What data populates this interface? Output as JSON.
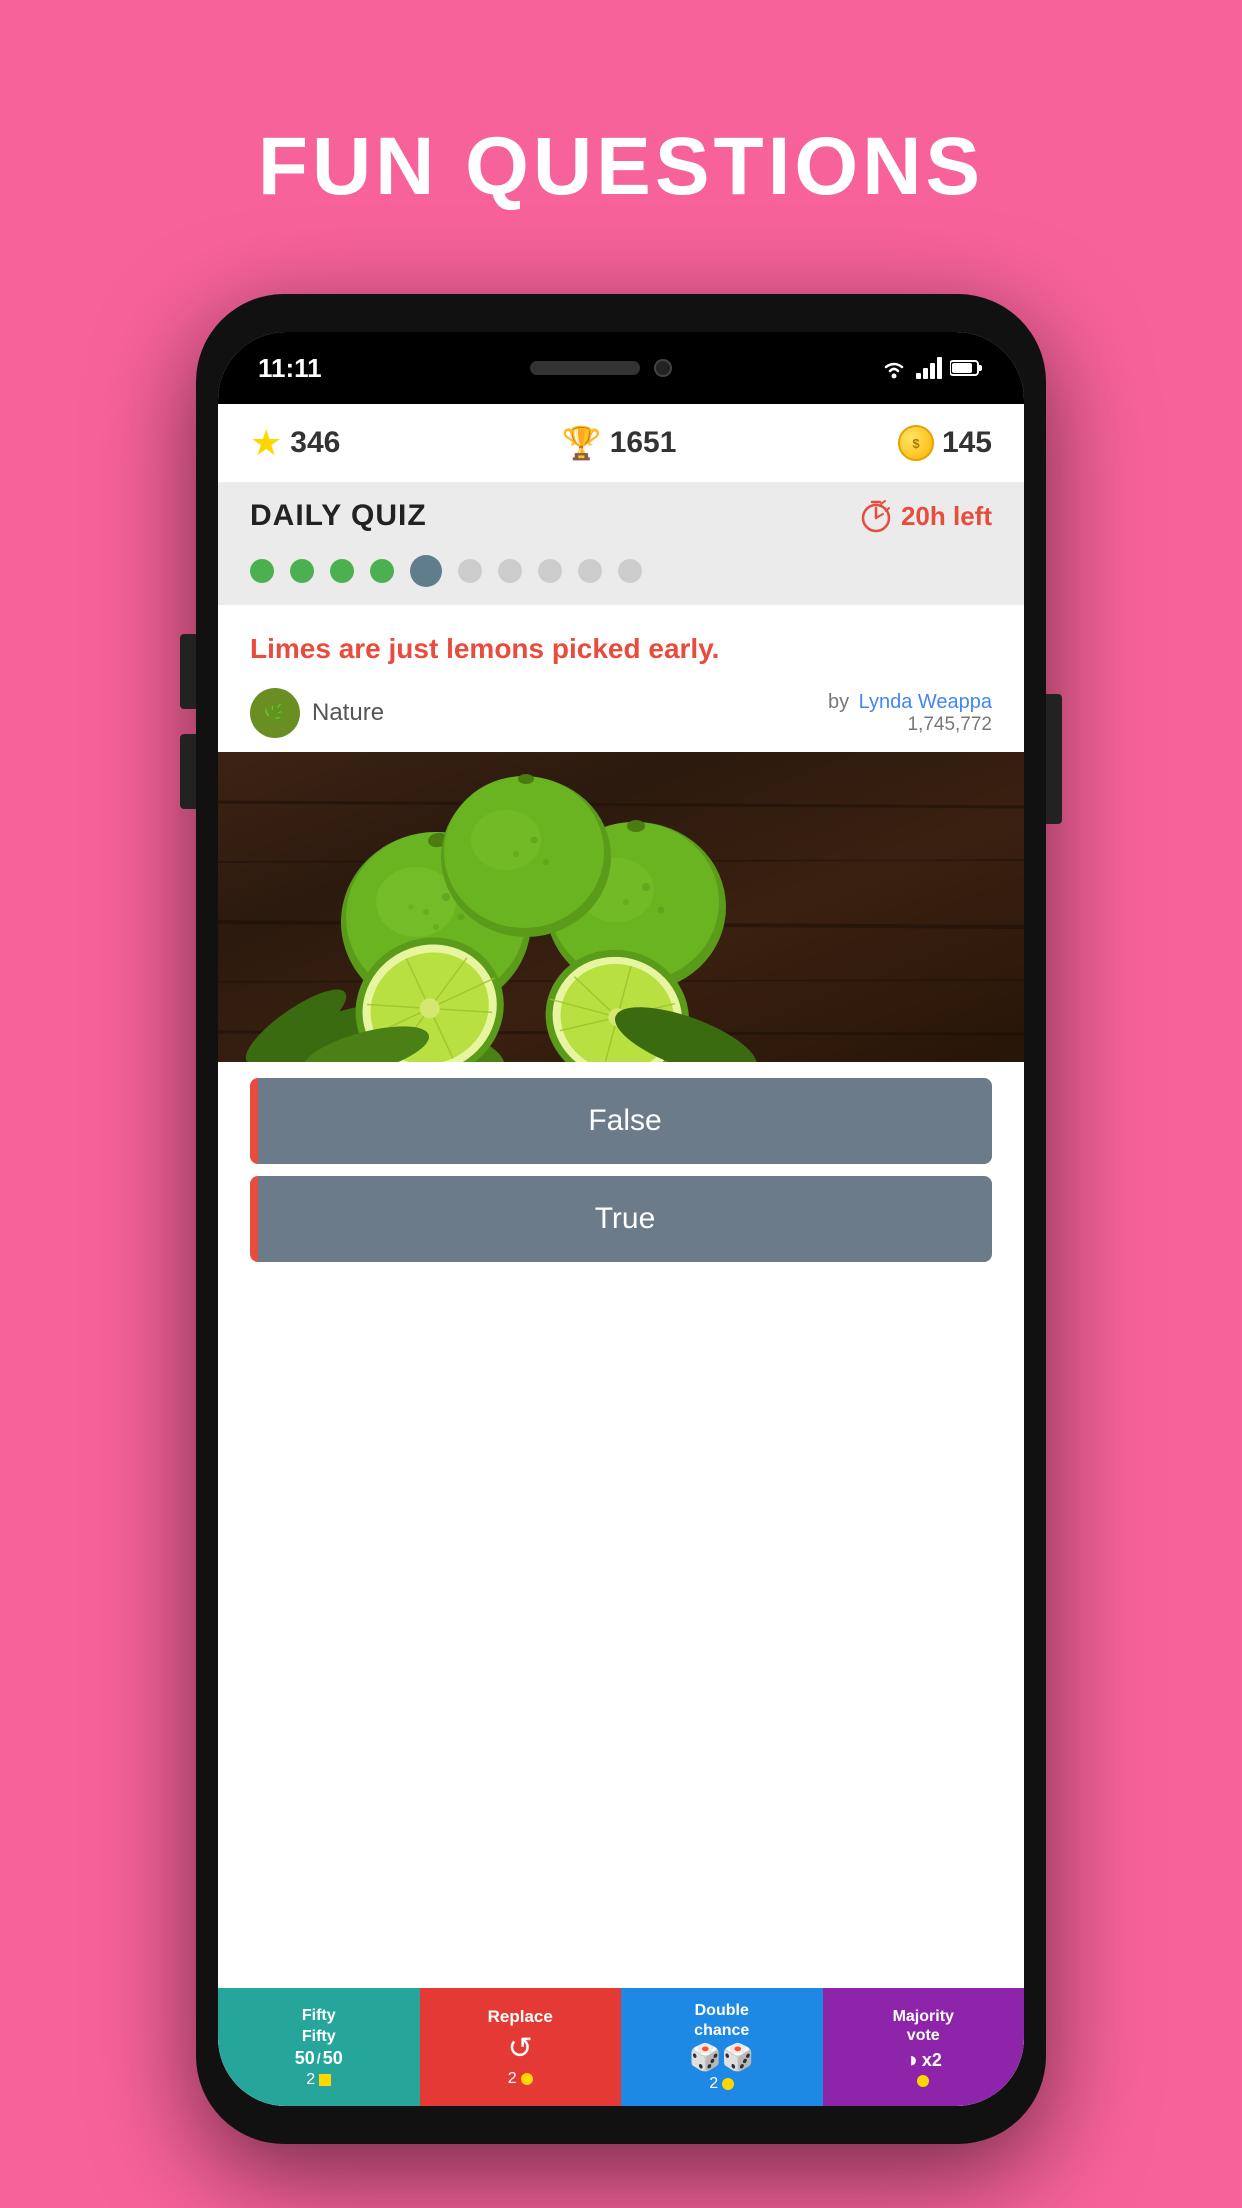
{
  "page": {
    "title": "FUN QUESTIONS",
    "background_color": "#F7629A"
  },
  "phone": {
    "time": "11:11",
    "status_bar": {
      "wifi": true,
      "signal": true,
      "battery": true
    }
  },
  "stats": {
    "stars_value": "346",
    "trophy_value": "1651",
    "coins_value": "145"
  },
  "daily_quiz": {
    "title": "DAILY QUIZ",
    "timer_text": "20h left",
    "progress_dots": [
      {
        "state": "completed"
      },
      {
        "state": "completed"
      },
      {
        "state": "completed"
      },
      {
        "state": "completed"
      },
      {
        "state": "current"
      },
      {
        "state": "pending"
      },
      {
        "state": "pending"
      },
      {
        "state": "pending"
      },
      {
        "state": "pending"
      },
      {
        "state": "pending"
      }
    ]
  },
  "question": {
    "text": "Limes are just lemons picked early.",
    "category": "Nature",
    "author_by": "by",
    "author_name": "Lynda Weappa",
    "author_count": "1,745,772"
  },
  "answers": [
    {
      "label": "False"
    },
    {
      "label": "True"
    }
  ],
  "powerups": [
    {
      "name": "fifty-fifty",
      "label": "Fifty\nFifty",
      "value": "50%",
      "icon": "50/50",
      "cost": "2"
    },
    {
      "name": "replace",
      "label": "Replace",
      "icon": "↺",
      "cost": "2"
    },
    {
      "name": "double-chance",
      "label": "Double\nchance",
      "icon": "⚄⚄",
      "cost": "2"
    },
    {
      "name": "majority-vote",
      "label": "Majority\nvote",
      "value": "x2",
      "icon": "◑",
      "cost": ""
    }
  ]
}
